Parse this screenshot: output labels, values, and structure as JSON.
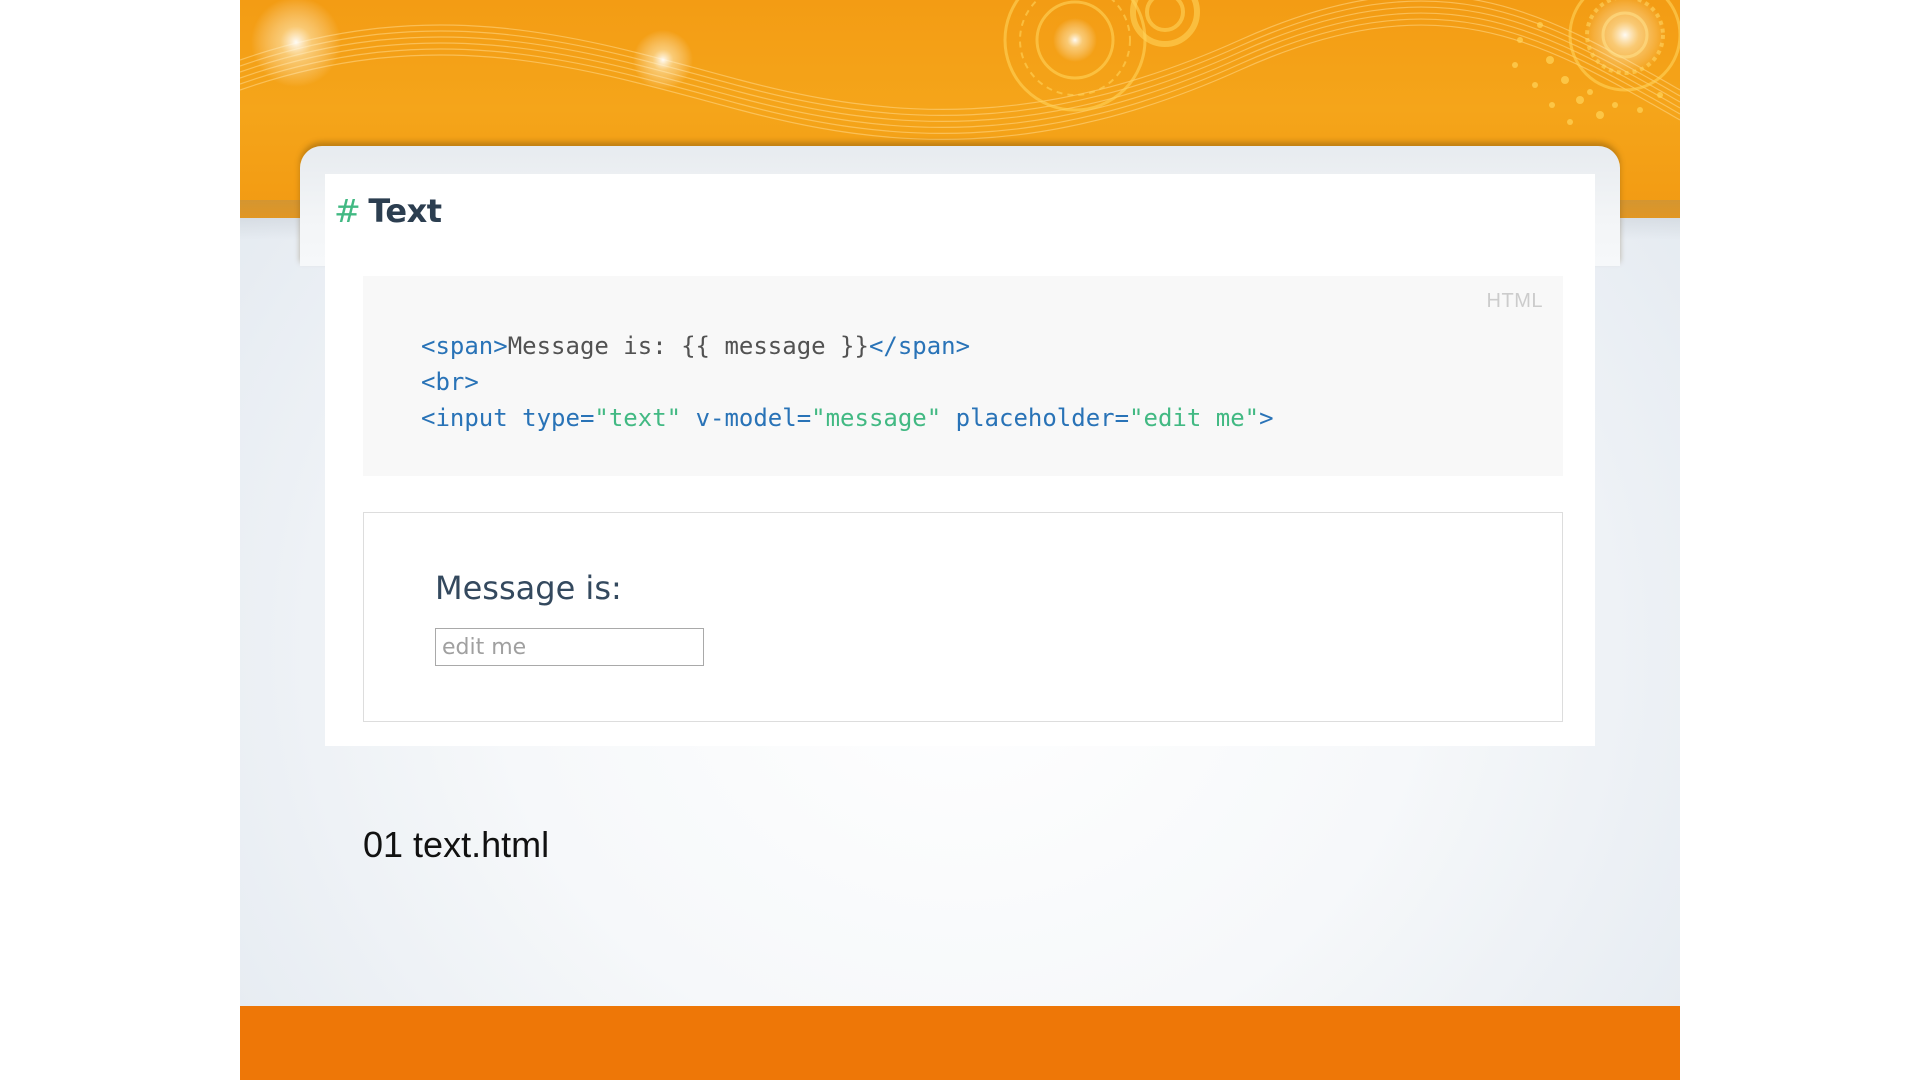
{
  "section": {
    "hash": "#",
    "title": "Text"
  },
  "code": {
    "language": "HTML",
    "lines": [
      [
        {
          "type": "tag",
          "text": "<span>"
        },
        {
          "type": "text",
          "text": "Message is: {{ message }}"
        },
        {
          "type": "tag",
          "text": "</span>"
        }
      ],
      [
        {
          "type": "tag",
          "text": "<br>"
        }
      ],
      [
        {
          "type": "tag",
          "text": "<input"
        },
        {
          "type": "text",
          "text": " "
        },
        {
          "type": "attr",
          "text": "type="
        },
        {
          "type": "str",
          "text": "\"text\""
        },
        {
          "type": "text",
          "text": " "
        },
        {
          "type": "attr",
          "text": "v-model="
        },
        {
          "type": "str",
          "text": "\"message\""
        },
        {
          "type": "text",
          "text": " "
        },
        {
          "type": "attr",
          "text": "placeholder="
        },
        {
          "type": "str",
          "text": "\"edit me\""
        },
        {
          "type": "tag",
          "text": ">"
        }
      ]
    ]
  },
  "demo": {
    "message_label": "Message is:",
    "input_value": "",
    "input_placeholder": "edit me"
  },
  "caption": "01 text.html",
  "colors": {
    "banner_orange": "#f5a51a",
    "footer_orange": "#ee7707",
    "accent_green": "#42b983",
    "code_blue": "#2973b7"
  }
}
